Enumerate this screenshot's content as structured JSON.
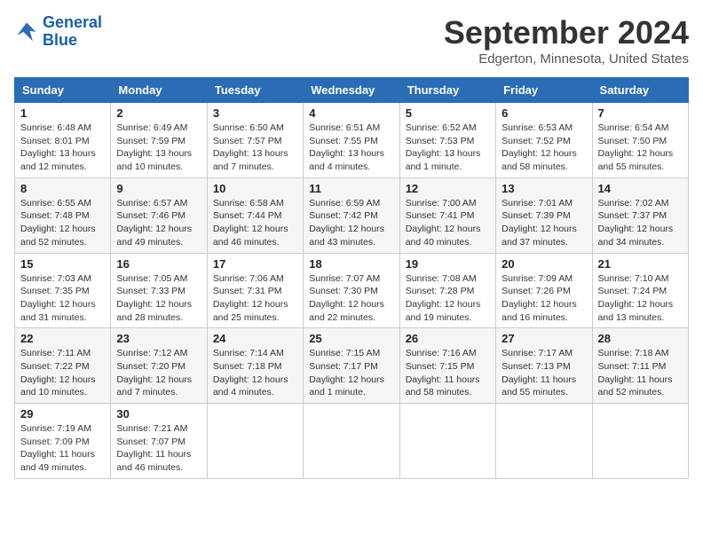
{
  "logo": {
    "line1": "General",
    "line2": "Blue"
  },
  "title": "September 2024",
  "subtitle": "Edgerton, Minnesota, United States",
  "days_of_week": [
    "Sunday",
    "Monday",
    "Tuesday",
    "Wednesday",
    "Thursday",
    "Friday",
    "Saturday"
  ],
  "weeks": [
    [
      {
        "day": "1",
        "sunrise": "Sunrise: 6:48 AM",
        "sunset": "Sunset: 8:01 PM",
        "daylight": "Daylight: 13 hours and 12 minutes."
      },
      {
        "day": "2",
        "sunrise": "Sunrise: 6:49 AM",
        "sunset": "Sunset: 7:59 PM",
        "daylight": "Daylight: 13 hours and 10 minutes."
      },
      {
        "day": "3",
        "sunrise": "Sunrise: 6:50 AM",
        "sunset": "Sunset: 7:57 PM",
        "daylight": "Daylight: 13 hours and 7 minutes."
      },
      {
        "day": "4",
        "sunrise": "Sunrise: 6:51 AM",
        "sunset": "Sunset: 7:55 PM",
        "daylight": "Daylight: 13 hours and 4 minutes."
      },
      {
        "day": "5",
        "sunrise": "Sunrise: 6:52 AM",
        "sunset": "Sunset: 7:53 PM",
        "daylight": "Daylight: 13 hours and 1 minute."
      },
      {
        "day": "6",
        "sunrise": "Sunrise: 6:53 AM",
        "sunset": "Sunset: 7:52 PM",
        "daylight": "Daylight: 12 hours and 58 minutes."
      },
      {
        "day": "7",
        "sunrise": "Sunrise: 6:54 AM",
        "sunset": "Sunset: 7:50 PM",
        "daylight": "Daylight: 12 hours and 55 minutes."
      }
    ],
    [
      {
        "day": "8",
        "sunrise": "Sunrise: 6:55 AM",
        "sunset": "Sunset: 7:48 PM",
        "daylight": "Daylight: 12 hours and 52 minutes."
      },
      {
        "day": "9",
        "sunrise": "Sunrise: 6:57 AM",
        "sunset": "Sunset: 7:46 PM",
        "daylight": "Daylight: 12 hours and 49 minutes."
      },
      {
        "day": "10",
        "sunrise": "Sunrise: 6:58 AM",
        "sunset": "Sunset: 7:44 PM",
        "daylight": "Daylight: 12 hours and 46 minutes."
      },
      {
        "day": "11",
        "sunrise": "Sunrise: 6:59 AM",
        "sunset": "Sunset: 7:42 PM",
        "daylight": "Daylight: 12 hours and 43 minutes."
      },
      {
        "day": "12",
        "sunrise": "Sunrise: 7:00 AM",
        "sunset": "Sunset: 7:41 PM",
        "daylight": "Daylight: 12 hours and 40 minutes."
      },
      {
        "day": "13",
        "sunrise": "Sunrise: 7:01 AM",
        "sunset": "Sunset: 7:39 PM",
        "daylight": "Daylight: 12 hours and 37 minutes."
      },
      {
        "day": "14",
        "sunrise": "Sunrise: 7:02 AM",
        "sunset": "Sunset: 7:37 PM",
        "daylight": "Daylight: 12 hours and 34 minutes."
      }
    ],
    [
      {
        "day": "15",
        "sunrise": "Sunrise: 7:03 AM",
        "sunset": "Sunset: 7:35 PM",
        "daylight": "Daylight: 12 hours and 31 minutes."
      },
      {
        "day": "16",
        "sunrise": "Sunrise: 7:05 AM",
        "sunset": "Sunset: 7:33 PM",
        "daylight": "Daylight: 12 hours and 28 minutes."
      },
      {
        "day": "17",
        "sunrise": "Sunrise: 7:06 AM",
        "sunset": "Sunset: 7:31 PM",
        "daylight": "Daylight: 12 hours and 25 minutes."
      },
      {
        "day": "18",
        "sunrise": "Sunrise: 7:07 AM",
        "sunset": "Sunset: 7:30 PM",
        "daylight": "Daylight: 12 hours and 22 minutes."
      },
      {
        "day": "19",
        "sunrise": "Sunrise: 7:08 AM",
        "sunset": "Sunset: 7:28 PM",
        "daylight": "Daylight: 12 hours and 19 minutes."
      },
      {
        "day": "20",
        "sunrise": "Sunrise: 7:09 AM",
        "sunset": "Sunset: 7:26 PM",
        "daylight": "Daylight: 12 hours and 16 minutes."
      },
      {
        "day": "21",
        "sunrise": "Sunrise: 7:10 AM",
        "sunset": "Sunset: 7:24 PM",
        "daylight": "Daylight: 12 hours and 13 minutes."
      }
    ],
    [
      {
        "day": "22",
        "sunrise": "Sunrise: 7:11 AM",
        "sunset": "Sunset: 7:22 PM",
        "daylight": "Daylight: 12 hours and 10 minutes."
      },
      {
        "day": "23",
        "sunrise": "Sunrise: 7:12 AM",
        "sunset": "Sunset: 7:20 PM",
        "daylight": "Daylight: 12 hours and 7 minutes."
      },
      {
        "day": "24",
        "sunrise": "Sunrise: 7:14 AM",
        "sunset": "Sunset: 7:18 PM",
        "daylight": "Daylight: 12 hours and 4 minutes."
      },
      {
        "day": "25",
        "sunrise": "Sunrise: 7:15 AM",
        "sunset": "Sunset: 7:17 PM",
        "daylight": "Daylight: 12 hours and 1 minute."
      },
      {
        "day": "26",
        "sunrise": "Sunrise: 7:16 AM",
        "sunset": "Sunset: 7:15 PM",
        "daylight": "Daylight: 11 hours and 58 minutes."
      },
      {
        "day": "27",
        "sunrise": "Sunrise: 7:17 AM",
        "sunset": "Sunset: 7:13 PM",
        "daylight": "Daylight: 11 hours and 55 minutes."
      },
      {
        "day": "28",
        "sunrise": "Sunrise: 7:18 AM",
        "sunset": "Sunset: 7:11 PM",
        "daylight": "Daylight: 11 hours and 52 minutes."
      }
    ],
    [
      {
        "day": "29",
        "sunrise": "Sunrise: 7:19 AM",
        "sunset": "Sunset: 7:09 PM",
        "daylight": "Daylight: 11 hours and 49 minutes."
      },
      {
        "day": "30",
        "sunrise": "Sunrise: 7:21 AM",
        "sunset": "Sunset: 7:07 PM",
        "daylight": "Daylight: 11 hours and 46 minutes."
      },
      null,
      null,
      null,
      null,
      null
    ]
  ]
}
